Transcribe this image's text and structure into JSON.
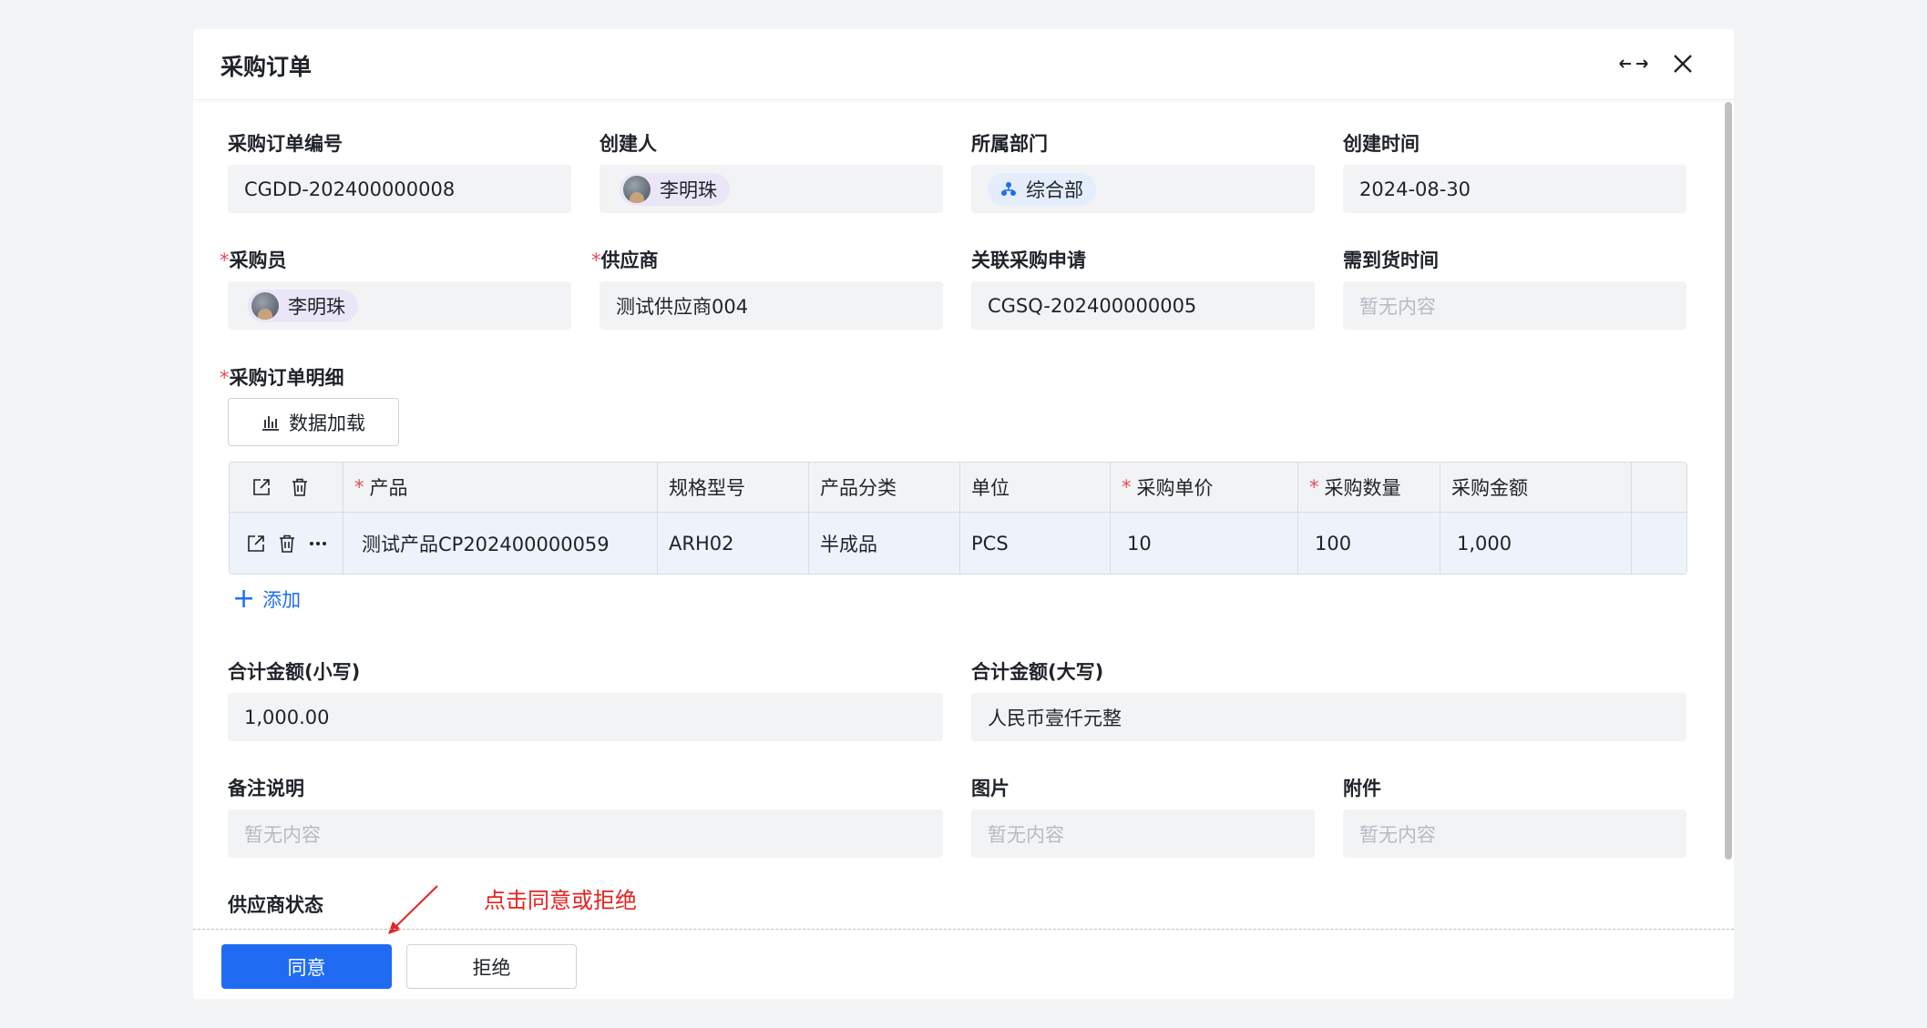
{
  "modal": {
    "title": "采购订单"
  },
  "fields": {
    "order_no": {
      "label": "采购订单编号",
      "value": "CGDD-202400000008"
    },
    "creator": {
      "label": "创建人",
      "value": "李明珠"
    },
    "department": {
      "label": "所属部门",
      "value": "综合部"
    },
    "created_at": {
      "label": "创建时间",
      "value": "2024-08-30"
    },
    "buyer": {
      "label": "采购员",
      "value": "李明珠"
    },
    "supplier": {
      "label": "供应商",
      "value": "测试供应商004"
    },
    "request": {
      "label": "关联采购申请",
      "value": "CGSQ-202400000005"
    },
    "delivery_time": {
      "label": "需到货时间",
      "placeholder": "暂无内容"
    },
    "details": {
      "label": "采购订单明细"
    },
    "total_small": {
      "label": "合计金额(小写)",
      "value": "1,000.00"
    },
    "total_big": {
      "label": "合计金额(大写)",
      "value": "人民币壹仟元整"
    },
    "remark": {
      "label": "备注说明",
      "placeholder": "暂无内容"
    },
    "image": {
      "label": "图片",
      "placeholder": "暂无内容"
    },
    "attachment": {
      "label": "附件",
      "placeholder": "暂无内容"
    },
    "supplier_status": {
      "label": "供应商状态"
    }
  },
  "required_mark": "*",
  "load_button": "数据加载",
  "table": {
    "headers": [
      "产品",
      "规格型号",
      "产品分类",
      "单位",
      "采购单价",
      "采购数量",
      "采购金额"
    ],
    "rows": [
      [
        "测试产品CP202400000059",
        "ARH02",
        "半成品",
        "PCS",
        "10",
        "100",
        "1,000"
      ]
    ]
  },
  "add_link": "添加",
  "annotation": "点击同意或拒绝",
  "footer": {
    "agree": "同意",
    "reject": "拒绝"
  },
  "colors": {
    "primary": "#1f6cf2",
    "required": "#e34d59",
    "annotation": "#e5231f"
  },
  "icons": [
    "expand-horizontal-icon",
    "close-icon",
    "bar-chart-icon",
    "open-link-icon",
    "trash-icon",
    "more-icon",
    "plus-icon",
    "department-icon"
  ]
}
